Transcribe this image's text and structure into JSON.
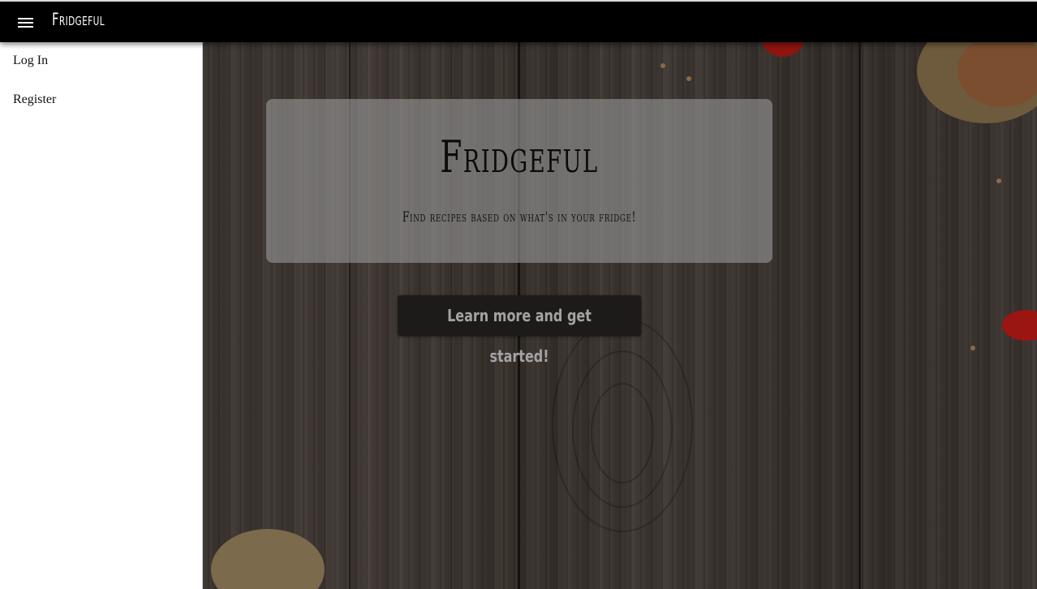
{
  "app": {
    "title": "Fridgeful"
  },
  "topbar": {
    "menu_icon": "hamburger-menu-icon"
  },
  "sidebar": {
    "items": [
      {
        "label": "Log In"
      },
      {
        "label": "Register"
      }
    ]
  },
  "hero": {
    "title": "Fridgeful",
    "subtitle": "Find recipes based on what's in your fridge!"
  },
  "cta": {
    "label": "Learn more and get started!"
  },
  "colors": {
    "topbar": "#000000",
    "sidebar": "#ffffff",
    "card": "#969696",
    "button": "#1c1b1a",
    "button_text": "#a3a3a3"
  }
}
